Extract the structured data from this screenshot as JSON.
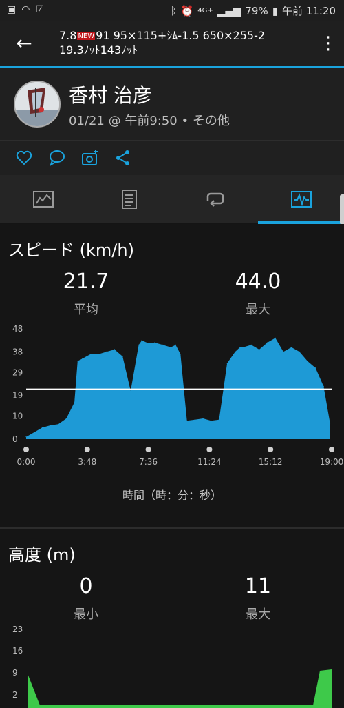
{
  "status_bar": {
    "battery": "79%",
    "time": "午前 11:20",
    "network": "4G+"
  },
  "app_bar": {
    "title_line1_a": "7.8",
    "new_badge": "NEW",
    "title_line1_b": "91 95×115+ｼﾑ-1.5 650×255-2",
    "title_line2": "19.3ﾉｯﾄ143ﾉｯﾄ"
  },
  "activity": {
    "user_name": "香村 治彦",
    "date_time": "01/21 @ 午前9:50",
    "separator": "•",
    "activity_type": "その他"
  },
  "tabs": [
    {
      "icon": "summary-chart-icon"
    },
    {
      "icon": "notes-icon"
    },
    {
      "icon": "laps-icon"
    },
    {
      "icon": "graphs-icon",
      "active": true
    }
  ],
  "speed": {
    "title": "スピード (km/h)",
    "avg_value": "21.7",
    "avg_label": "平均",
    "max_value": "44.0",
    "max_label": "最大",
    "axis_label": "時間（時：分：秒）"
  },
  "altitude": {
    "title": "高度 (m)",
    "min_value": "0",
    "min_label": "最小",
    "max_value": "11",
    "max_label": "最大"
  },
  "colors": {
    "accent": "#1aa3dd",
    "speed_fill": "#1e9ad6",
    "altitude_fill": "#3ec94a"
  },
  "chart_data": [
    {
      "type": "area",
      "title": "スピード (km/h)",
      "xlabel": "時間（時：分：秒）",
      "x_ticks": [
        "0:00",
        "3:48",
        "7:36",
        "11:24",
        "15:12",
        "19:00"
      ],
      "y_ticks": [
        0,
        10,
        19,
        29,
        38,
        48
      ],
      "ylim": [
        0,
        48
      ],
      "x_minutes": [
        0,
        0.5,
        1,
        1.5,
        2,
        2.5,
        3,
        3.2,
        3.5,
        4,
        4.5,
        5,
        5.5,
        6,
        6.5,
        7,
        7.2,
        7.5,
        8,
        8.5,
        9,
        9.3,
        9.6,
        10,
        10.5,
        11,
        11.5,
        12,
        12.5,
        13,
        13.3,
        13.5,
        14,
        14.5,
        15,
        15.5,
        16,
        16.5,
        17,
        17.5,
        18,
        18.5,
        18.9
      ],
      "values": [
        1,
        3,
        5,
        6,
        6.5,
        9,
        16,
        34,
        35,
        37,
        37,
        38,
        39,
        36,
        21,
        41,
        43,
        42,
        42,
        41,
        40,
        41,
        37,
        8,
        8.5,
        9,
        8,
        8.5,
        33,
        38,
        40,
        40,
        41,
        39,
        42,
        44,
        38,
        40,
        38,
        34,
        31,
        23,
        7
      ],
      "average": 21.7
    },
    {
      "type": "area",
      "title": "高度 (m)",
      "y_ticks": [
        2,
        9,
        16,
        23
      ]
    }
  ]
}
